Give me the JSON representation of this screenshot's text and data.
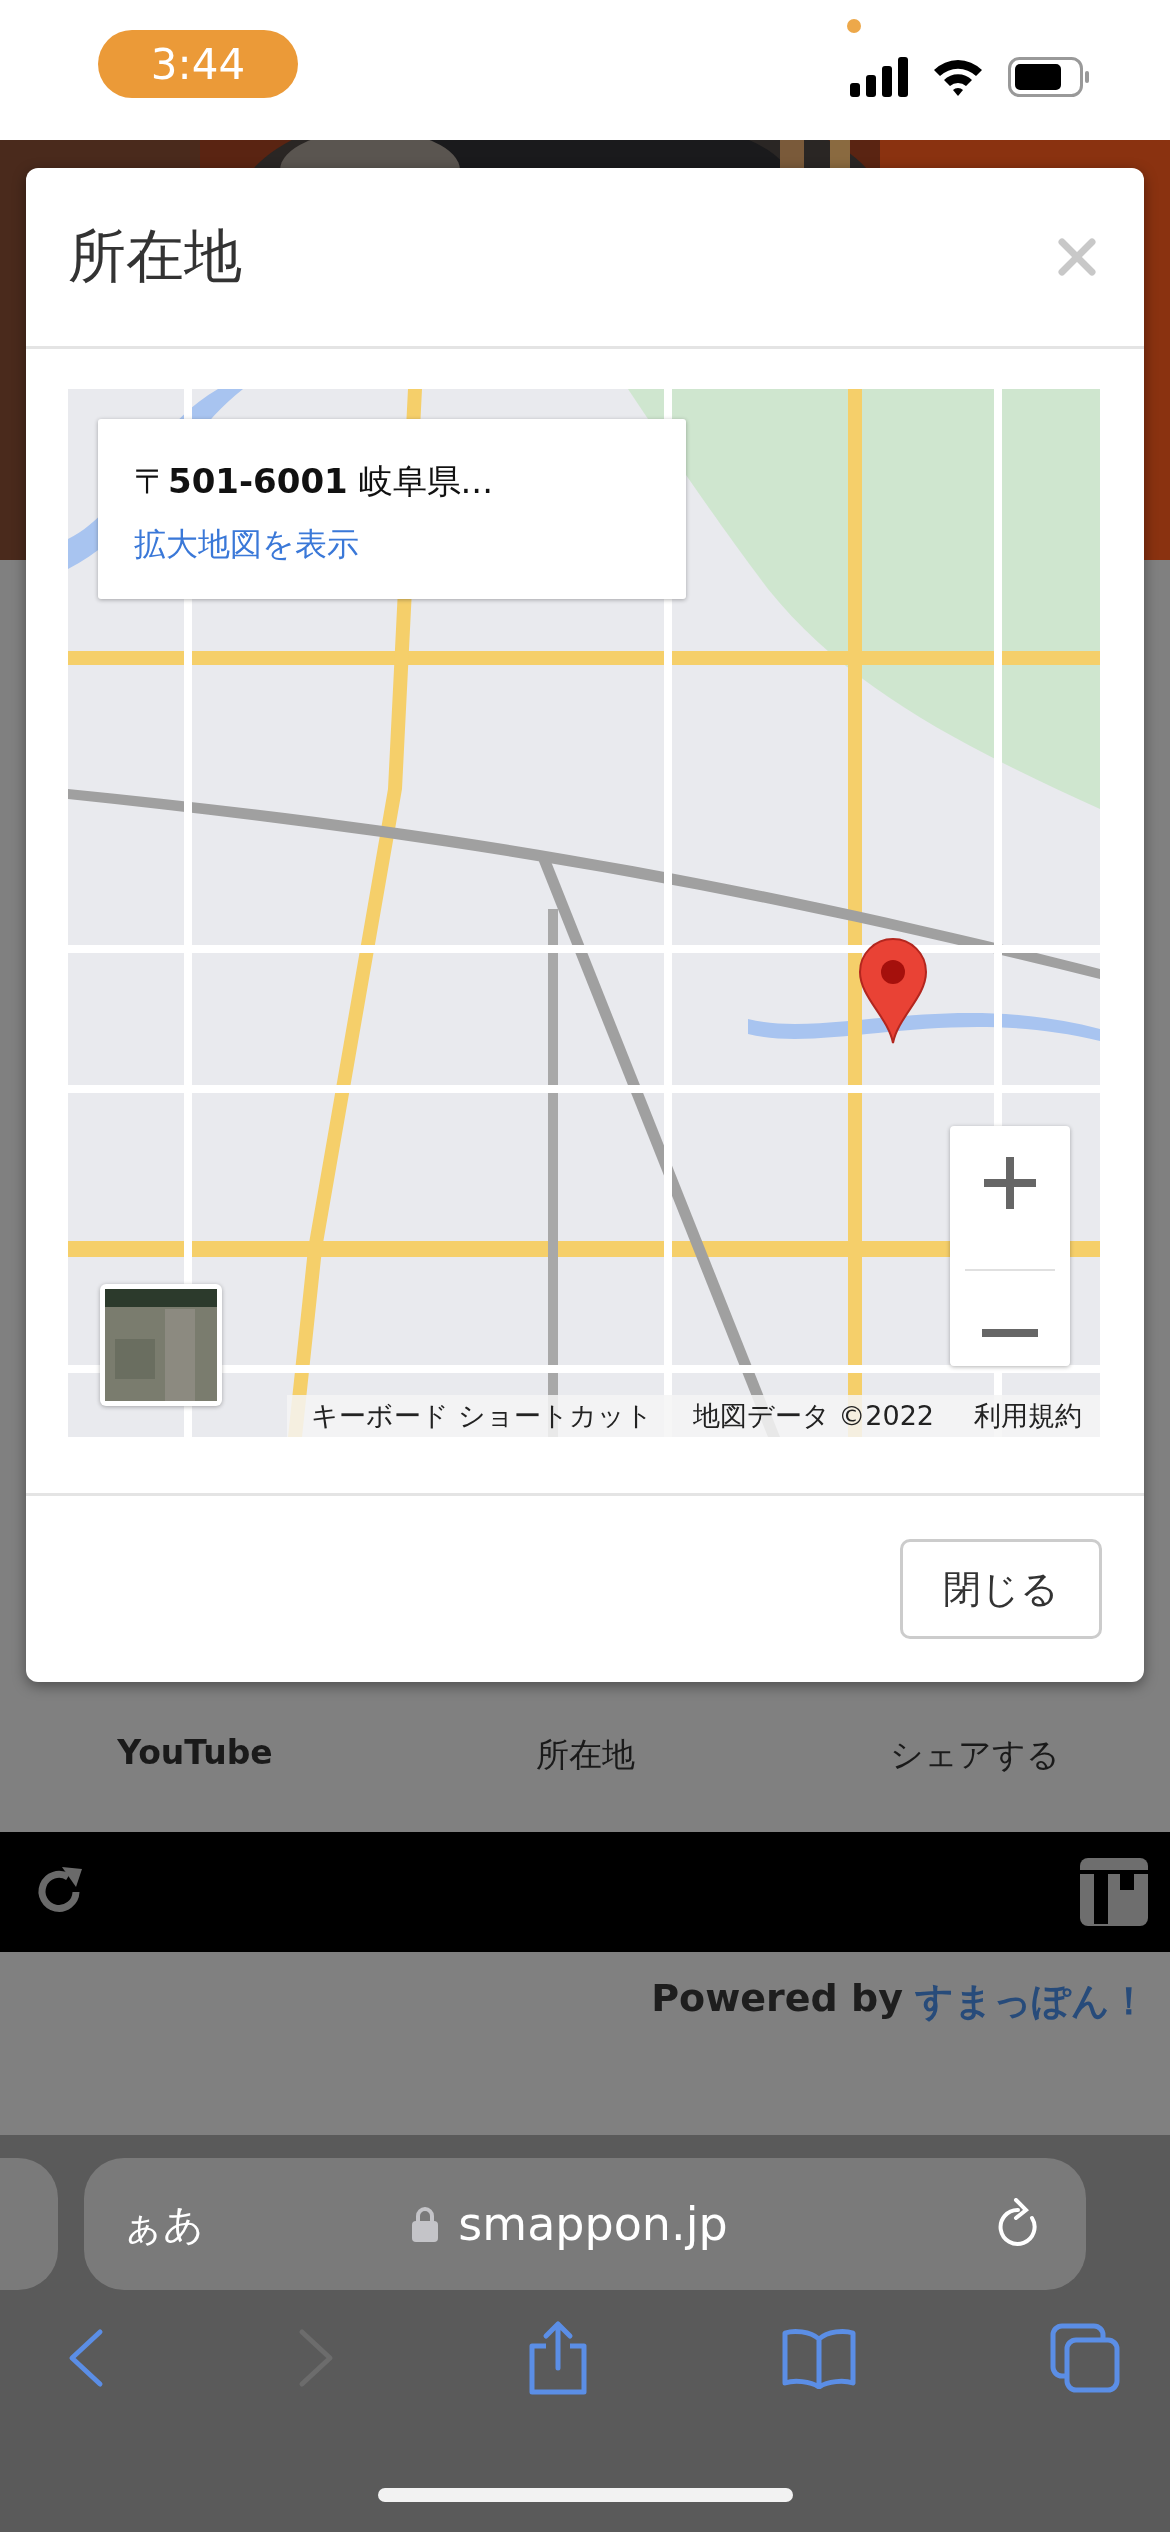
{
  "status_bar": {
    "time": "3:44"
  },
  "modal": {
    "title": "所在地",
    "map": {
      "kind": "picture",
      "info_card": {
        "address": "〒**501-6001** 岐阜県...",
        "link": "拡大地図を表示"
      },
      "attribution": [
        "キーボード ショートカット",
        "地図データ ©2022",
        "利用規約"
      ]
    },
    "close_button": "閉じる"
  },
  "tabs": [
    {
      "label": "YouTube",
      "selected": true
    },
    {
      "label": "所在地",
      "selected": false
    },
    {
      "label": "シェアする",
      "selected": false
    }
  ],
  "footer": {
    "powered_by": "Powered by",
    "brand": "すまっぽん！"
  },
  "browser": {
    "text_size_button": "ぁあ",
    "url": "smappon.jp"
  }
}
